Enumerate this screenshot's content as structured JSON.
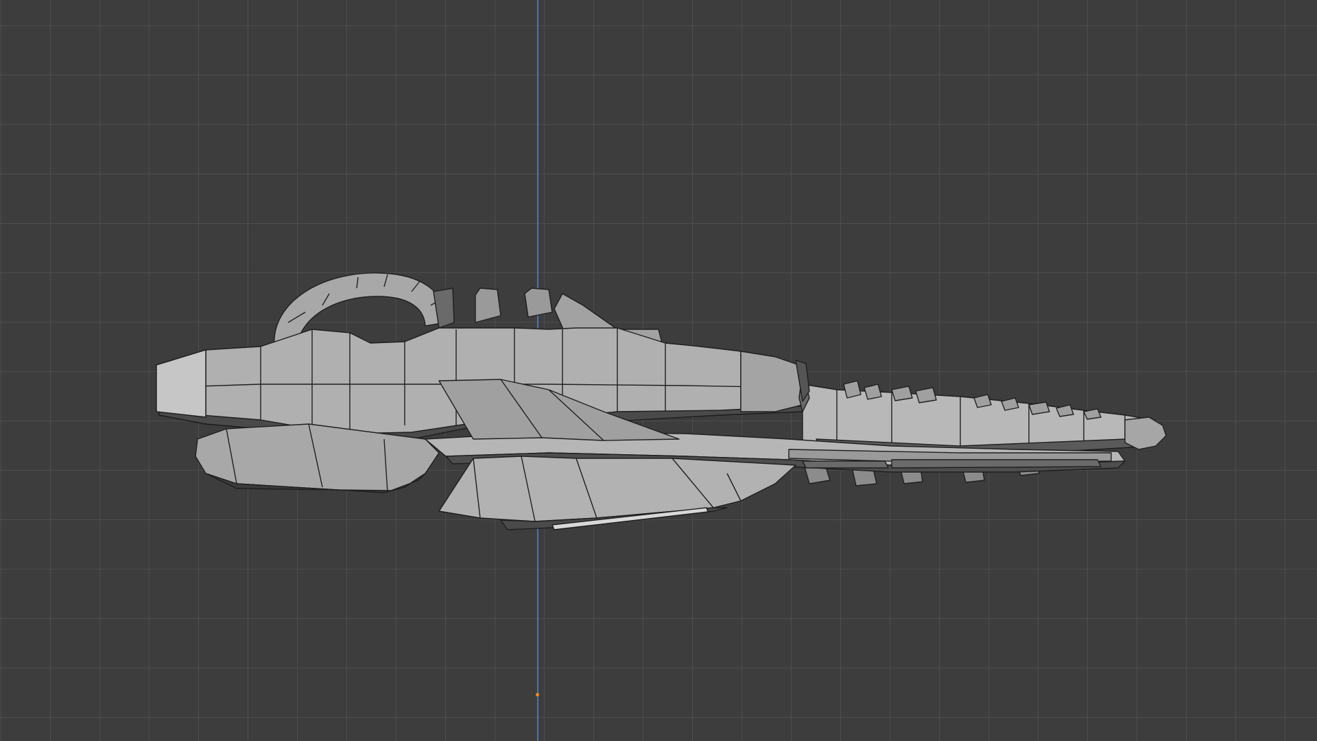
{
  "viewport": {
    "background_color": "#3d3d3d",
    "grid_color": "#505050",
    "axis_z_color": "#3f7ed4",
    "origin_color": "#f08a1c",
    "mesh_light_color": "#b4b4b4",
    "mesh_mid_color": "#8c8c8c",
    "mesh_dark_color": "#4a4a4a",
    "wire_color": "#1e1e1e"
  },
  "scene_object": {
    "icon": "spaceship-mesh-icon"
  }
}
